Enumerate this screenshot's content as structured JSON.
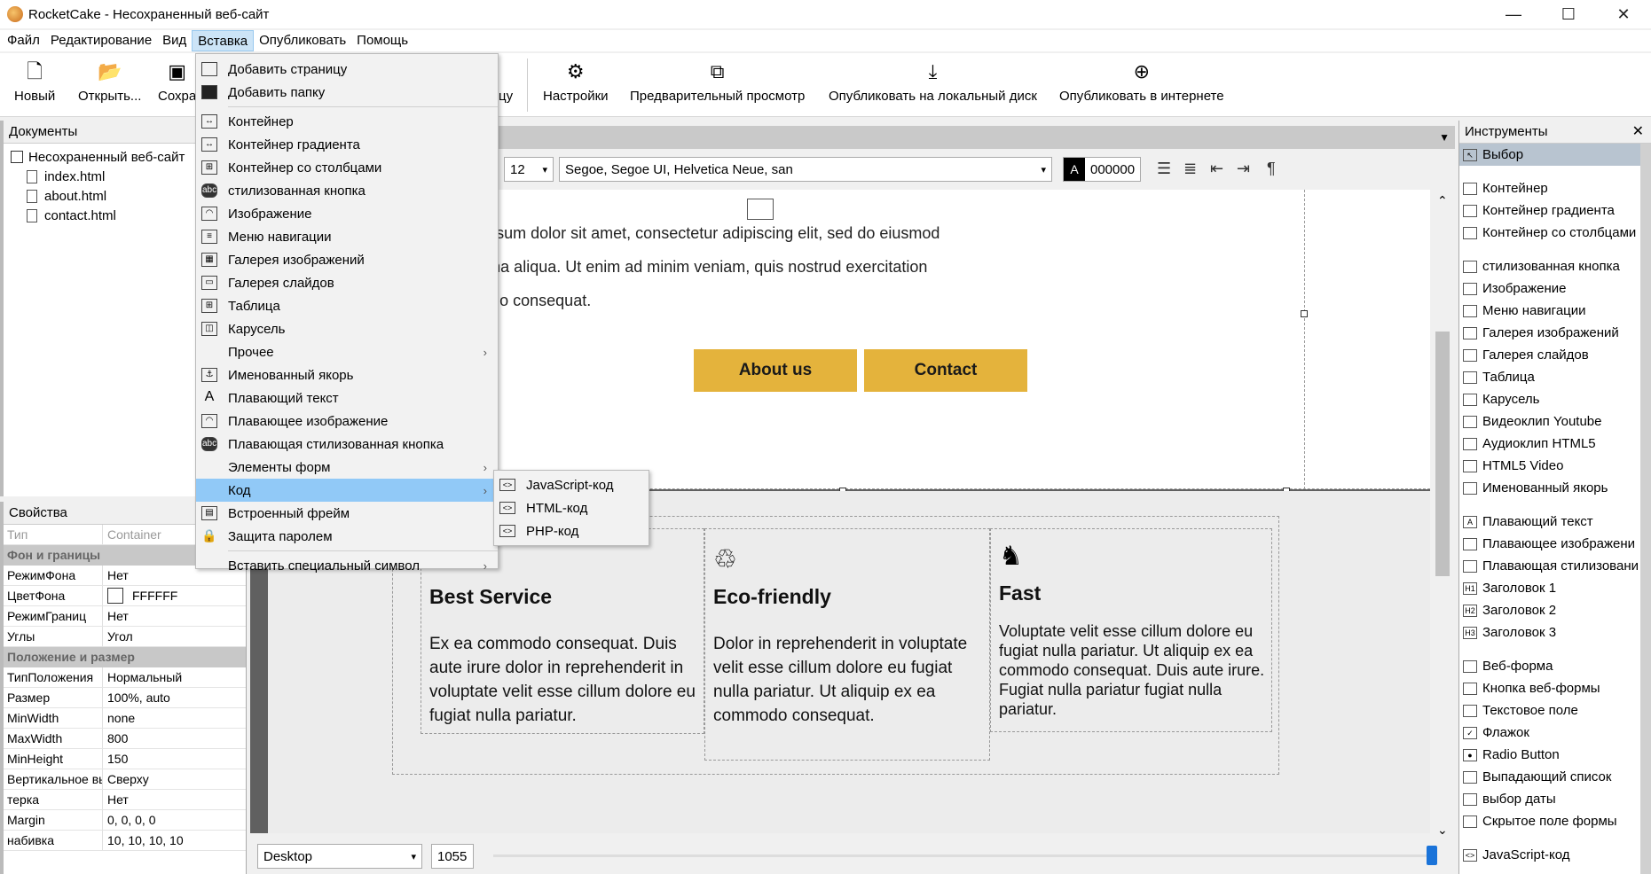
{
  "window": {
    "title": "RocketCake - Несохраненный веб-сайт",
    "minimize": "—",
    "maximize": "☐",
    "close": "✕"
  },
  "menubar": [
    "Файл",
    "Редактирование",
    "Вид",
    "Вставка",
    "Опубликовать",
    "Помощь"
  ],
  "toolbar": {
    "new": "Новый",
    "open": "Открыть...",
    "save": "Сохра",
    "save_as_tail": "цу",
    "settings": "Настройки",
    "preview": "Предварительный просмотр",
    "publish_local": "Опубликовать на локальный диск",
    "publish_web": "Опубликовать в интернете"
  },
  "documents": {
    "title": "Документы",
    "root": "Несохраненный веб-сайт",
    "files": [
      "index.html",
      "about.html",
      "contact.html"
    ]
  },
  "properties": {
    "title": "Свойства",
    "type_key": "Тип",
    "type_val": "Container",
    "group1": "Фон и границы",
    "rows1": [
      [
        "РежимФона",
        "Нет"
      ],
      [
        "ЦветФона",
        "FFFFFF"
      ],
      [
        "РежимГраниц",
        "Нет"
      ],
      [
        "Углы",
        "Угол"
      ]
    ],
    "group2": "Положение и размер",
    "rows2": [
      [
        "ТипПоложения",
        "Нормальный"
      ],
      [
        "Размер",
        "100%, auto"
      ],
      [
        "MinWidth",
        "none"
      ],
      [
        "MaxWidth",
        "800"
      ],
      [
        "MinHeight",
        "150"
      ],
      [
        "Вертикальное выр",
        "Сверху"
      ],
      [
        "терка",
        "Нет"
      ],
      [
        "Margin",
        "0, 0, 0, 0"
      ],
      [
        "набивка",
        "10, 10, 10, 10"
      ]
    ]
  },
  "format": {
    "size": "12",
    "font": "Segoe, Segoe UI, Helvetica Neue, san",
    "color_letter": "A",
    "color": "000000"
  },
  "page": {
    "lorem": "mple this nice placholder text: Ipsum dolor sit amet, consectetur adipiscing elit, sed do eiusmod\ncididunt ut labore et dolore magna aliqua. Ut enim ad minim veniam, quis nostrud exercitation\noris nisi ut aliquip ex ea commodo consequat.",
    "btn_about": "About us",
    "btn_contact": "Contact",
    "features": [
      {
        "icon": "☼",
        "title": "Best Service",
        "text": "Ex ea commodo consequat. Duis aute irure dolor in reprehenderit in voluptate velit esse cillum dolore eu fugiat nulla pariatur."
      },
      {
        "icon": "♲",
        "title": "Eco-friendly",
        "text": "Dolor in reprehenderit in voluptate velit esse cillum dolore eu fugiat nulla pariatur. Ut aliquip ex ea commodo consequat."
      },
      {
        "icon": "♞",
        "title": "Fast",
        "text": "Voluptate velit esse cillum dolore eu fugiat nulla pariatur. Ut aliquip ex ea commodo consequat. Duis aute irure. Fugiat nulla pariatur fugiat nulla pariatur."
      }
    ]
  },
  "bottom": {
    "view": "Desktop",
    "width": "1055"
  },
  "tools": {
    "title": "Инструменты",
    "selected": "Выбор",
    "groups": [
      [
        "Контейнер",
        "Контейнер градиента",
        "Контейнер со столбцами"
      ],
      [
        "стилизованная кнопка",
        "Изображение",
        "Меню навигации",
        "Галерея изображений",
        "Галерея слайдов",
        "Таблица",
        "Карусель",
        "Видеоклип Youtube",
        "Аудиоклип HTML5",
        "HTML5 Video",
        "Именованный якорь"
      ],
      [
        "Плавающий текст",
        "Плавающее изображени",
        "Плавающая стилизовани",
        "Заголовок 1",
        "Заголовок 2",
        "Заголовок 3"
      ],
      [
        "Веб-форма",
        "Кнопка веб-формы",
        "Текстовое поле",
        "Флажок",
        "Radio Button",
        "Выпадающий список",
        "выбор даты",
        "Скрытое поле формы"
      ],
      [
        "JavaScript-код"
      ]
    ]
  },
  "insert_menu": {
    "group1": [
      "Добавить страницу",
      "Добавить папку"
    ],
    "group2": [
      "Контейнер",
      "Контейнер градиента",
      "Контейнер со столбцами",
      "стилизованная кнопка",
      "Изображение",
      "Меню навигации",
      "Галерея изображений",
      "Галерея слайдов",
      "Таблица",
      "Карусель"
    ],
    "other": "Прочее",
    "group3": [
      "Именованный якорь",
      "Плавающий текст",
      "Плавающее изображение",
      "Плавающая стилизованная кнопка"
    ],
    "forms": "Элементы форм",
    "code": "Код",
    "group4": [
      "Встроенный фрейм",
      "Защита паролем"
    ],
    "special": "Вставить специальный символ",
    "code_sub": [
      "JavaScript-код",
      "HTML-код",
      "PHP-код"
    ]
  }
}
